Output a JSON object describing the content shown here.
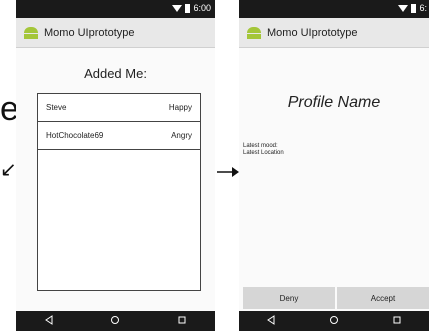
{
  "left_screen": {
    "status_time": "6:00",
    "app_title": "Momo UIprototype",
    "section_title": "Added Me:",
    "friends": [
      {
        "name": "Steve",
        "mood": "Happy"
      },
      {
        "name": "HotChocolate69",
        "mood": "Angry"
      }
    ]
  },
  "right_screen": {
    "status_time": "6:",
    "app_title": "Momo UIprototype",
    "profile_name": "Profile Name",
    "latest_mood_label": "Latest mood:",
    "latest_location_label": "Latest Location",
    "deny_label": "Deny",
    "accept_label": "Accept"
  },
  "edge_glyphs": {
    "top": "e",
    "bottom": "↙"
  },
  "colors": {
    "status_bar": "#1a1a1a",
    "app_bar": "#e8e8e8",
    "android_green": "#a4c639",
    "button_gray": "#d6d6d6"
  }
}
